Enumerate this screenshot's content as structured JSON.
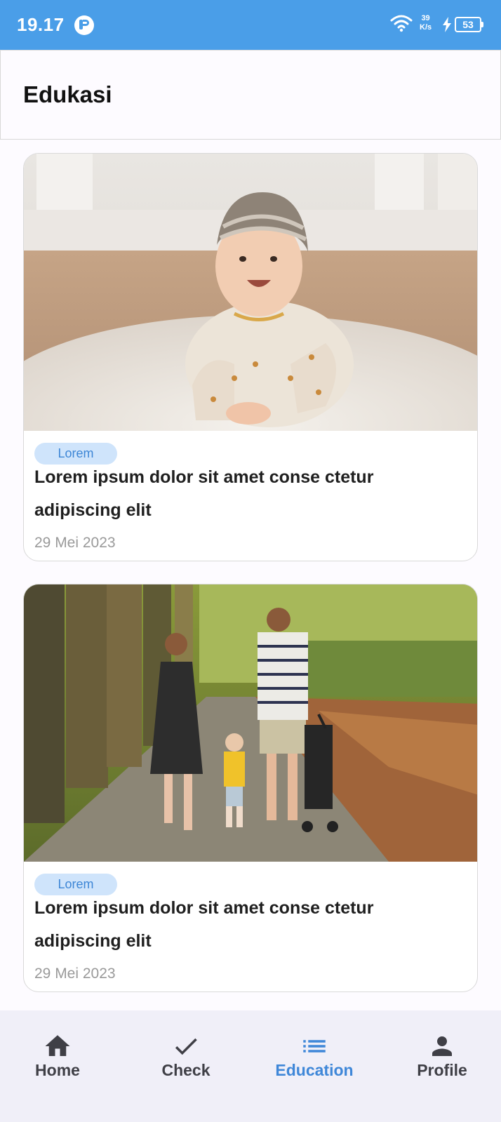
{
  "status_bar": {
    "time": "19.17",
    "net_speed_value": "39",
    "net_speed_unit": "K/s",
    "battery": "53"
  },
  "header": {
    "title": "Edukasi"
  },
  "articles": [
    {
      "tag": "Lorem",
      "title": "Lorem ipsum dolor sit amet conse ctetur adipiscing elit",
      "date": "29 Mei 2023"
    },
    {
      "tag": "Lorem",
      "title": "Lorem ipsum dolor sit amet conse ctetur adipiscing elit",
      "date": "29 Mei 2023"
    }
  ],
  "bottom_nav": {
    "items": [
      {
        "label": "Home",
        "icon": "home-icon"
      },
      {
        "label": "Check",
        "icon": "check-icon"
      },
      {
        "label": "Education",
        "icon": "list-icon"
      },
      {
        "label": "Profile",
        "icon": "person-icon"
      }
    ],
    "active_index": 2
  },
  "colors": {
    "status_bar": "#4a9ee8",
    "accent": "#3f87d8",
    "tag_bg": "#cfe4fb",
    "nav_bg": "#f0eff8"
  }
}
